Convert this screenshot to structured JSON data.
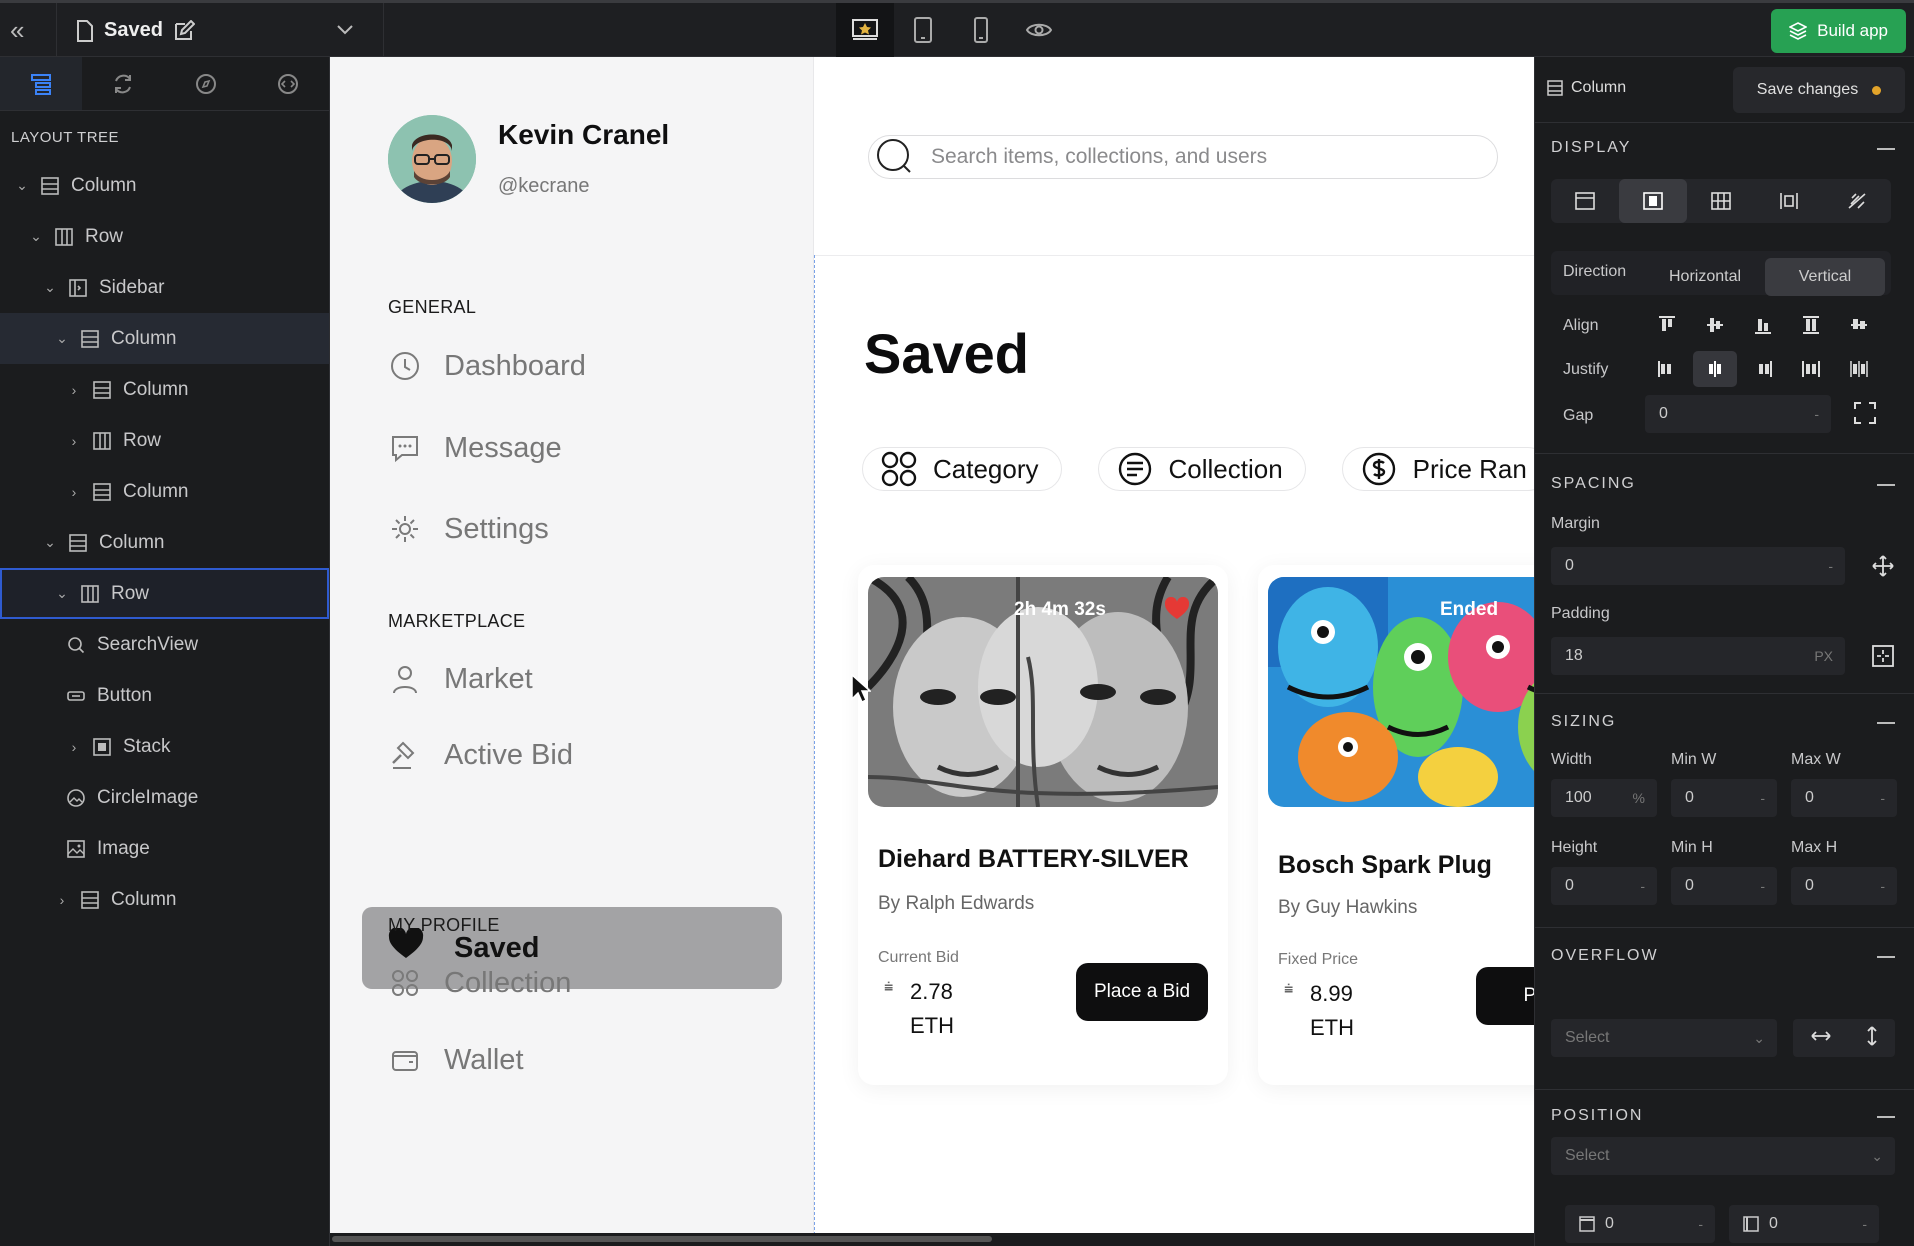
{
  "topbar": {
    "file_title": "Saved",
    "build_label": "Build app"
  },
  "left_panel": {
    "title": "LAYOUT TREE",
    "tree": [
      {
        "label": "Column"
      },
      {
        "label": "Row"
      },
      {
        "label": "Sidebar"
      },
      {
        "label": "Column"
      },
      {
        "label": "Column"
      },
      {
        "label": "Row"
      },
      {
        "label": "Column"
      },
      {
        "label": "Column"
      },
      {
        "label": "Row"
      },
      {
        "label": "SearchView"
      },
      {
        "label": "Button"
      },
      {
        "label": "Stack"
      },
      {
        "label": "CircleImage"
      },
      {
        "label": "Image"
      },
      {
        "label": "Column"
      }
    ]
  },
  "profile": {
    "name": "Kevin Cranel",
    "handle": "@kecrane"
  },
  "nav": {
    "general_label": "GENERAL",
    "dashboard": "Dashboard",
    "message": "Message",
    "settings": "Settings",
    "marketplace_label": "MARKETPLACE",
    "market": "Market",
    "active_bid": "Active Bid",
    "saved": "Saved",
    "my_profile_label": "MY PROFILE",
    "collection": "Collection",
    "wallet": "Wallet"
  },
  "main": {
    "search_placeholder": "Search items, collections, and users",
    "page_title": "Saved",
    "filters": [
      "Category",
      "Collection",
      "Price Ran"
    ],
    "cards": [
      {
        "title": "Diehard BATTERY-SILVER",
        "author": "By Ralph Edwards",
        "price_label": "Current Bid",
        "price": "2.78",
        "currency": "ETH",
        "badge": "2h 4m 32s",
        "button": "Place a Bid"
      },
      {
        "title": "Bosch Spark Plug",
        "author": "By Guy Hawkins",
        "price_label": "Fixed Price",
        "price": "8.99",
        "currency": "ETH",
        "badge": "Ended",
        "button": "Plac"
      }
    ]
  },
  "inspector": {
    "component": "Column",
    "save_label": "Save changes",
    "display": {
      "section": "DISPLAY",
      "direction_label": "Direction",
      "horizontal": "Horizontal",
      "vertical": "Vertical",
      "align_label": "Align",
      "justify_label": "Justify",
      "gap_label": "Gap",
      "gap_value": "0"
    },
    "spacing": {
      "section": "SPACING",
      "margin_label": "Margin",
      "margin_value": "0",
      "padding_label": "Padding",
      "padding_value": "18",
      "padding_unit": "PX"
    },
    "sizing": {
      "section": "SIZING",
      "width_label": "Width",
      "width_value": "100",
      "width_unit": "%",
      "minw_label": "Min W",
      "minw_value": "0",
      "maxw_label": "Max W",
      "maxw_value": "0",
      "height_label": "Height",
      "height_value": "0",
      "minh_label": "Min H",
      "minh_value": "0",
      "maxh_label": "Max H",
      "maxh_value": "0"
    },
    "overflow": {
      "section": "OVERFLOW",
      "select": "Select"
    },
    "position": {
      "section": "POSITION",
      "select": "Select",
      "top_value": "0",
      "left_value": "0"
    }
  }
}
